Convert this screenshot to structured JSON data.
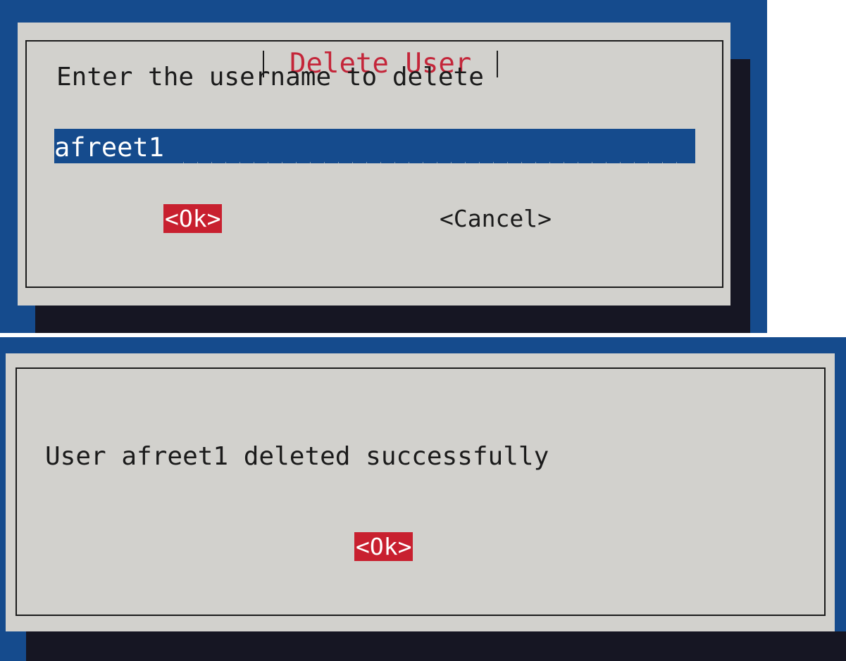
{
  "delete_dialog": {
    "title": "Delete User",
    "prompt": "Enter the username to delete",
    "username_value": "afreet1",
    "ok_label": "<Ok>",
    "cancel_label": "<Cancel>"
  },
  "result_dialog": {
    "message": "User afreet1 deleted successfully",
    "ok_label": "<Ok>"
  },
  "colors": {
    "background_blue": "#154b8d",
    "dialog_gray": "#d2d1cd",
    "shadow": "#161623",
    "accent_red": "#c8202f",
    "title_red": "#c4263a"
  }
}
